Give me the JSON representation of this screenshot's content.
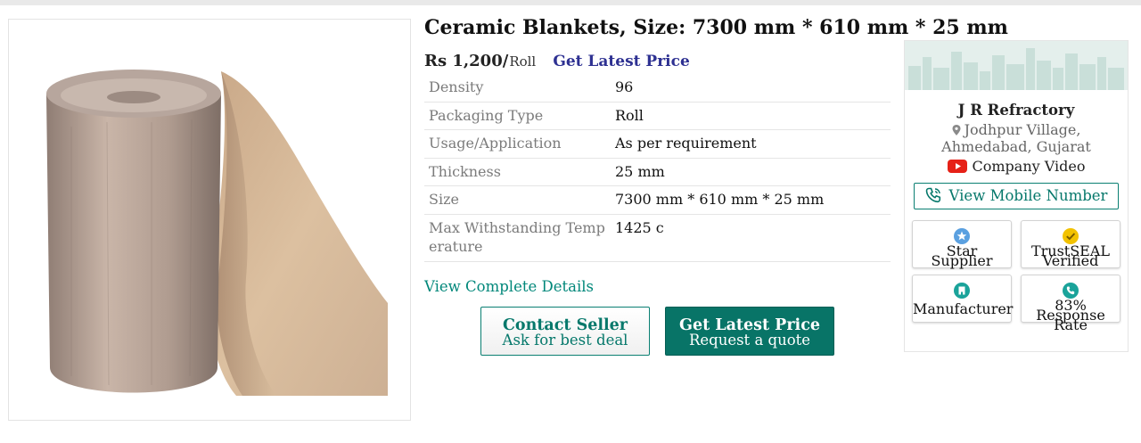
{
  "product": {
    "title": "Ceramic Blankets, Size: 7300 mm * 610 mm * 25 mm",
    "price": "Rs 1,200/",
    "unit": "Roll",
    "latest_price_link": "Get Latest Price",
    "image_icon": "ceramic-blanket-roll-photo"
  },
  "specs": [
    {
      "label": "Density",
      "value": "96"
    },
    {
      "label": "Packaging Type",
      "value": "Roll"
    },
    {
      "label": "Usage/Application",
      "value": "As per requirement"
    },
    {
      "label": "Thickness",
      "value": "25 mm"
    },
    {
      "label": "Size",
      "value": "7300 mm * 610 mm * 25 mm"
    },
    {
      "label": "Max Withstanding Temp",
      "label_cont": "erature",
      "value": "1425 c"
    }
  ],
  "links": {
    "details": "View Complete Details"
  },
  "buttons": {
    "contact": {
      "line1": "Contact Seller",
      "line2": "Ask for best deal"
    },
    "quote": {
      "line1": "Get Latest Price",
      "line2": "Request a quote"
    }
  },
  "seller": {
    "name": "J R Refractory",
    "location_line1": "Jodhpur Village,",
    "location_line2": "Ahmedabad, Gujarat",
    "video": "Company Video",
    "mobile_button": "View Mobile Number",
    "badges": [
      {
        "icon": "star-icon",
        "line1": "Star",
        "line2": "Supplier",
        "color": "#5aa0e0"
      },
      {
        "icon": "trustseal-check-icon",
        "line1": "TrustSEAL",
        "line2": "Verified",
        "color": "#f2c200"
      },
      {
        "icon": "factory-icon",
        "line1": "Manufacturer",
        "line2": "",
        "color": "#1aa39a"
      },
      {
        "icon": "phone-response-icon",
        "line1": "83%",
        "line2": "Response",
        "line3": "Rate",
        "color": "#1aa39a"
      }
    ]
  },
  "colors": {
    "brand_teal": "#087467",
    "link_navy": "#2e3192",
    "link_teal": "#00877a",
    "youtube_red": "#e62117"
  }
}
